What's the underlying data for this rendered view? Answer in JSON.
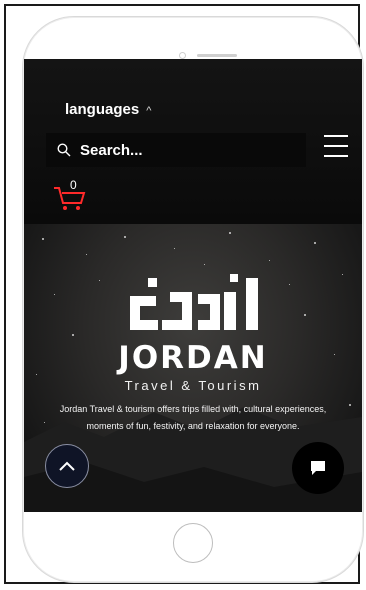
{
  "header": {
    "language_label": "languages",
    "language_caret": "^",
    "search_placeholder": "Search...",
    "cart_count": "0"
  },
  "hero": {
    "logo_arabic": "الأردن",
    "logo_english": "JORDAN",
    "tagline": "Travel & Tourism",
    "description": "Jordan Travel & tourism offers trips filled with, cultural experiences, moments of fun, festivity, and relaxation for everyone."
  },
  "colors": {
    "cart_accent": "#ff2a2a",
    "header_bg": "#111111",
    "chat_button_bg": "#000000"
  },
  "icons": [
    "search-icon",
    "hamburger-menu-icon",
    "shopping-cart-icon",
    "chevron-up-icon",
    "chat-icon"
  ]
}
